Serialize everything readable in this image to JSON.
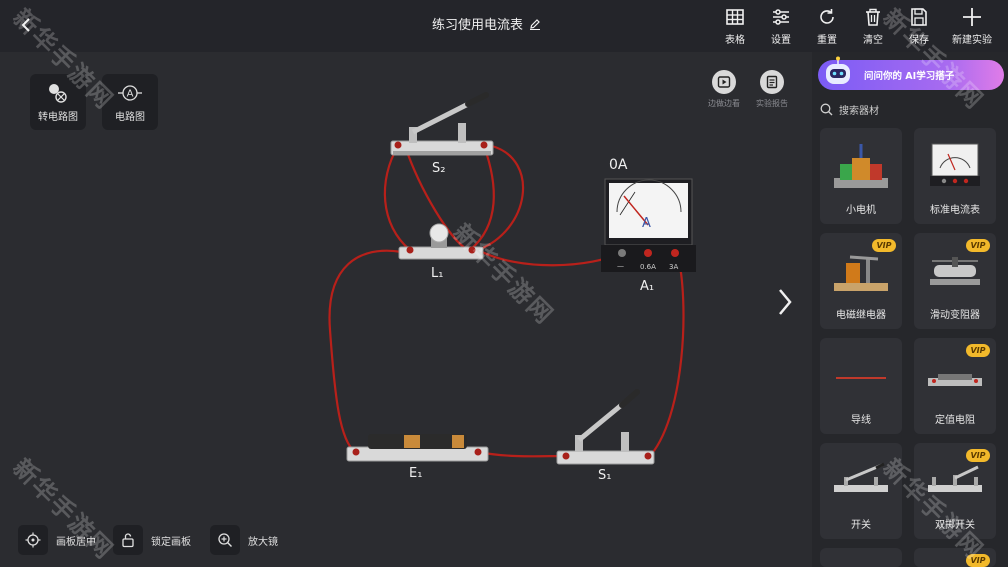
{
  "header": {
    "title": "练习使用电流表",
    "tools": [
      {
        "label": "表格",
        "icon": "table-icon"
      },
      {
        "label": "设置",
        "icon": "settings-sliders-icon"
      },
      {
        "label": "重置",
        "icon": "reset-icon"
      },
      {
        "label": "清空",
        "icon": "trash-icon"
      },
      {
        "label": "保存",
        "icon": "save-icon"
      },
      {
        "label": "新建实验",
        "icon": "plus-icon"
      }
    ]
  },
  "canvas": {
    "quick_actions": [
      {
        "label": "转电路图",
        "icon": "convert-circuit-icon"
      },
      {
        "label": "电路图",
        "icon": "ammeter-symbol-icon"
      }
    ],
    "top_right": [
      {
        "label": "边做边看",
        "icon": "play-icon"
      },
      {
        "label": "实验报告",
        "icon": "report-icon"
      }
    ],
    "bottom_tools": [
      {
        "label": "画板居中",
        "icon": "target-icon"
      },
      {
        "label": "锁定画板",
        "icon": "lock-icon"
      },
      {
        "label": "放大镜",
        "icon": "zoom-in-icon"
      }
    ],
    "components": {
      "switch_s2": "S₂",
      "lamp_l1": "L₁",
      "ammeter_a1": "A₁",
      "ammeter_reading": "0A",
      "ammeter_terminals": [
        "—",
        "0.6A",
        "3A"
      ],
      "ammeter_unit": "A",
      "battery_e1": "E₁",
      "switch_s1": "S₁"
    }
  },
  "panel": {
    "ai_banner": "问问你的  AI学习搭子",
    "search_placeholder": "搜索器材",
    "vip_label": "VIP",
    "items": [
      {
        "name": "小电机",
        "vip": false
      },
      {
        "name": "标准电流表",
        "vip": false
      },
      {
        "name": "电磁继电器",
        "vip": true
      },
      {
        "name": "滑动变阻器",
        "vip": true
      },
      {
        "name": "导线",
        "vip": false
      },
      {
        "name": "定值电阻",
        "vip": true
      },
      {
        "name": "开关",
        "vip": false
      },
      {
        "name": "双掷开关",
        "vip": true
      }
    ]
  },
  "watermark": "新华手游网",
  "colors": {
    "wire": "#b8201a",
    "accent": "#8a63f2",
    "vip": "#f2b92b"
  }
}
